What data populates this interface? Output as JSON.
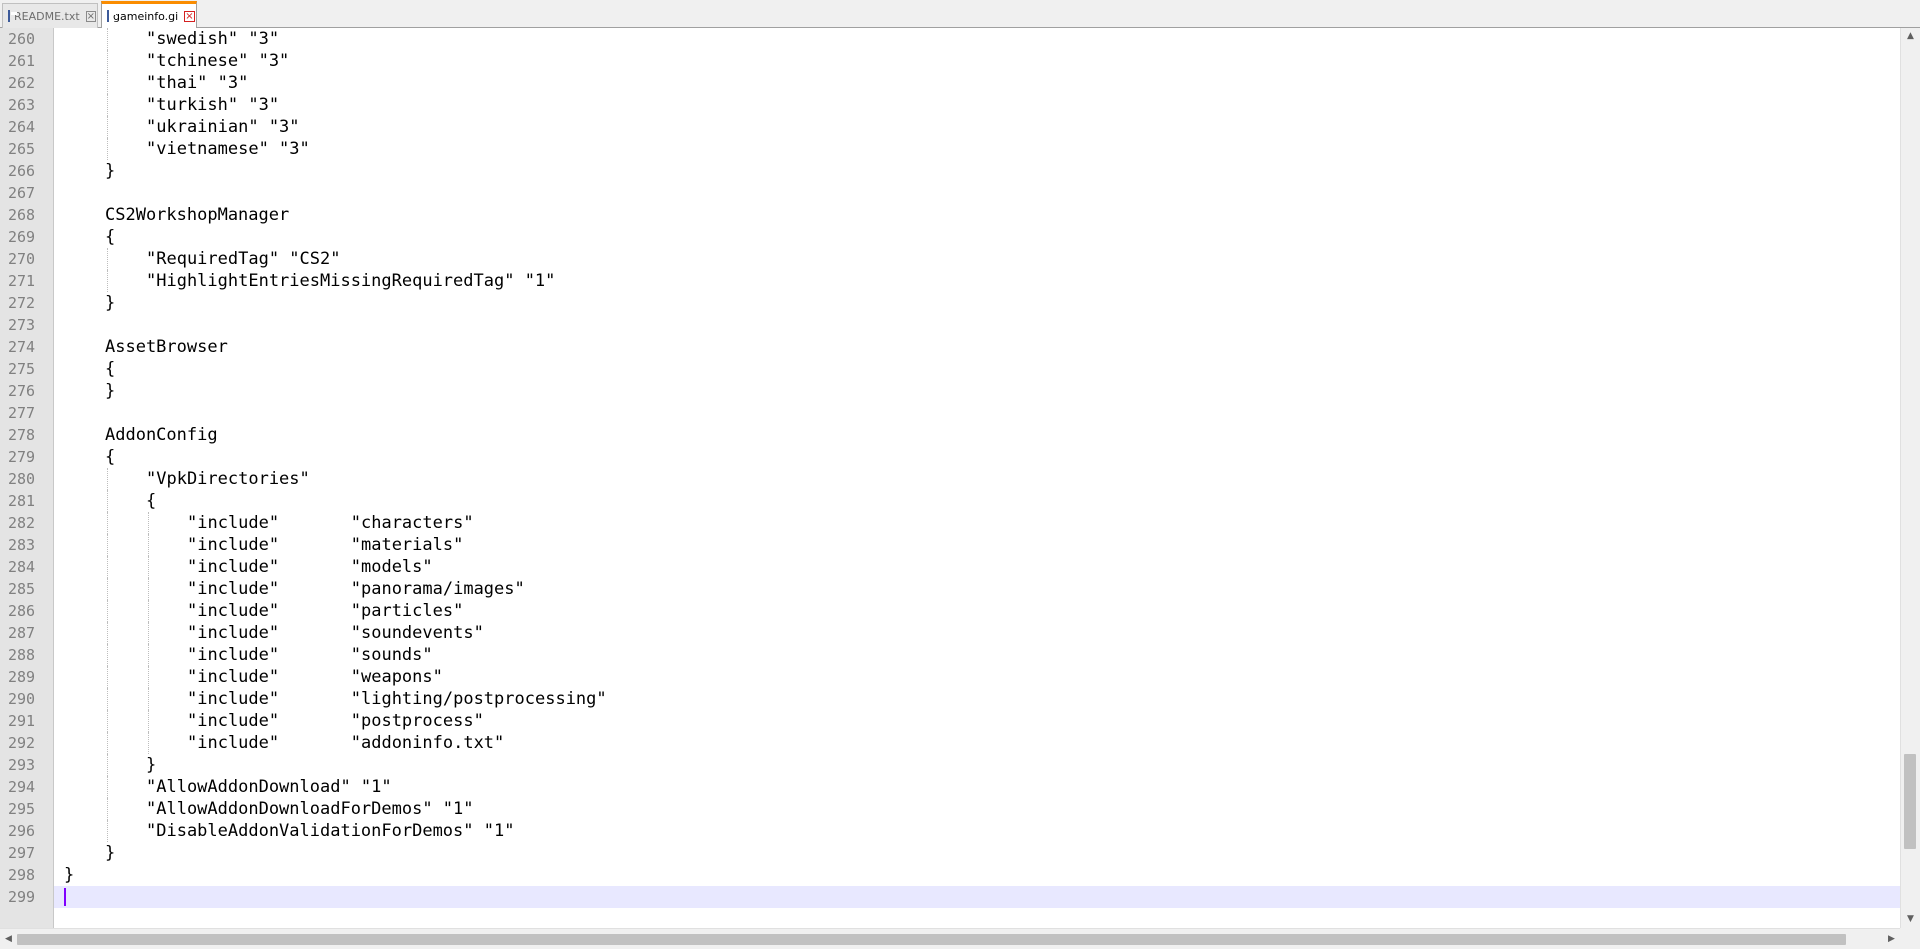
{
  "tabs": [
    {
      "label": "README.txt",
      "active": false,
      "icon": "file-icon",
      "close_icon": "close-icon"
    },
    {
      "label": "gameinfo.gi",
      "active": true,
      "icon": "file-icon",
      "close_icon": "close-icon"
    }
  ],
  "editor": {
    "current_line": 299,
    "lines": [
      {
        "n": "260",
        "indent": 2,
        "text": "\"swedish\" \"3\""
      },
      {
        "n": "261",
        "indent": 2,
        "text": "\"tchinese\" \"3\""
      },
      {
        "n": "262",
        "indent": 2,
        "text": "\"thai\" \"3\""
      },
      {
        "n": "263",
        "indent": 2,
        "text": "\"turkish\" \"3\""
      },
      {
        "n": "264",
        "indent": 2,
        "text": "\"ukrainian\" \"3\""
      },
      {
        "n": "265",
        "indent": 2,
        "text": "\"vietnamese\" \"3\""
      },
      {
        "n": "266",
        "indent": 1,
        "text": "}"
      },
      {
        "n": "267",
        "indent": 0,
        "text": ""
      },
      {
        "n": "268",
        "indent": 1,
        "text": "CS2WorkshopManager"
      },
      {
        "n": "269",
        "indent": 1,
        "text": "{"
      },
      {
        "n": "270",
        "indent": 2,
        "text": "\"RequiredTag\" \"CS2\""
      },
      {
        "n": "271",
        "indent": 2,
        "text": "\"HighlightEntriesMissingRequiredTag\" \"1\""
      },
      {
        "n": "272",
        "indent": 1,
        "text": "}"
      },
      {
        "n": "273",
        "indent": 0,
        "text": ""
      },
      {
        "n": "274",
        "indent": 1,
        "text": "AssetBrowser"
      },
      {
        "n": "275",
        "indent": 1,
        "text": "{"
      },
      {
        "n": "276",
        "indent": 1,
        "text": "}"
      },
      {
        "n": "277",
        "indent": 0,
        "text": ""
      },
      {
        "n": "278",
        "indent": 1,
        "text": "AddonConfig"
      },
      {
        "n": "279",
        "indent": 1,
        "text": "{"
      },
      {
        "n": "280",
        "indent": 2,
        "text": "\"VpkDirectories\""
      },
      {
        "n": "281",
        "indent": 2,
        "text": "{"
      },
      {
        "n": "282",
        "indent": 3,
        "text": "\"include\"       \"characters\""
      },
      {
        "n": "283",
        "indent": 3,
        "text": "\"include\"       \"materials\""
      },
      {
        "n": "284",
        "indent": 3,
        "text": "\"include\"       \"models\""
      },
      {
        "n": "285",
        "indent": 3,
        "text": "\"include\"       \"panorama/images\""
      },
      {
        "n": "286",
        "indent": 3,
        "text": "\"include\"       \"particles\""
      },
      {
        "n": "287",
        "indent": 3,
        "text": "\"include\"       \"soundevents\""
      },
      {
        "n": "288",
        "indent": 3,
        "text": "\"include\"       \"sounds\""
      },
      {
        "n": "289",
        "indent": 3,
        "text": "\"include\"       \"weapons\""
      },
      {
        "n": "290",
        "indent": 3,
        "text": "\"include\"       \"lighting/postprocessing\""
      },
      {
        "n": "291",
        "indent": 3,
        "text": "\"include\"       \"postprocess\""
      },
      {
        "n": "292",
        "indent": 3,
        "text": "\"include\"       \"addoninfo.txt\""
      },
      {
        "n": "293",
        "indent": 2,
        "text": "}"
      },
      {
        "n": "294",
        "indent": 2,
        "text": "\"AllowAddonDownload\" \"1\""
      },
      {
        "n": "295",
        "indent": 2,
        "text": "\"AllowAddonDownloadForDemos\" \"1\""
      },
      {
        "n": "296",
        "indent": 2,
        "text": "\"DisableAddonValidationForDemos\" \"1\""
      },
      {
        "n": "297",
        "indent": 1,
        "text": "}"
      },
      {
        "n": "298",
        "indent": 0,
        "text": "}"
      },
      {
        "n": "299",
        "indent": 0,
        "text": ""
      }
    ]
  },
  "scrollbars": {
    "vertical": {
      "position": 0.92,
      "thumb_fraction": 0.11,
      "up_icon": "arrow-up-icon",
      "down_icon": "arrow-down-icon"
    },
    "horizontal": {
      "position": 0.0,
      "thumb_fraction": 0.98,
      "left_icon": "arrow-left-icon",
      "right_icon": "arrow-right-icon"
    }
  },
  "colors": {
    "active_tab_accent": "#fa8c00",
    "current_line": "#e8e8ff",
    "caret": "#8000ff"
  }
}
